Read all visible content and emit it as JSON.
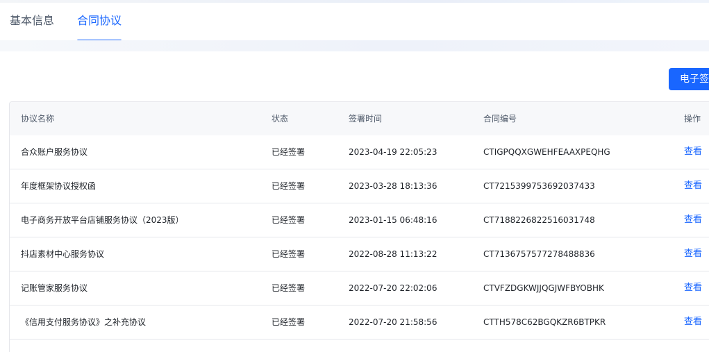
{
  "tabs": [
    {
      "label": "基本信息",
      "active": false
    },
    {
      "label": "合同协议",
      "active": true
    }
  ],
  "toolbar": {
    "e_sign_label": "电子签"
  },
  "table": {
    "headers": [
      "协议名称",
      "状态",
      "签署时间",
      "合同编号",
      "操作"
    ],
    "rows": [
      {
        "name": "合众账户服务协议",
        "status": "已经签署",
        "time": "2023-04-19 22:05:23",
        "id": "CTIGPQQXGWEHFEAAXPEQHG",
        "action": "查看"
      },
      {
        "name": "年度框架协议授权函",
        "status": "已经签署",
        "time": "2023-03-28 18:13:36",
        "id": "CT7215399753692037433",
        "action": "查看"
      },
      {
        "name": "电子商务开放平台店铺服务协议（2023版）",
        "status": "已经签署",
        "time": "2023-01-15 06:48:16",
        "id": "CT7188226822516031748",
        "action": "查看"
      },
      {
        "name": "抖店素材中心服务协议",
        "status": "已经签署",
        "time": "2022-08-28 11:13:22",
        "id": "CT7136757577278488836",
        "action": "查看"
      },
      {
        "name": "记账管家服务协议",
        "status": "已经签署",
        "time": "2022-07-20 22:02:06",
        "id": "CTVFZDGKWJJQGJWFBYOBHK",
        "action": "查看"
      },
      {
        "name": "《信用支付服务协议》之补充协议",
        "status": "已经签署",
        "time": "2022-07-20 21:58:56",
        "id": "CTTH578C62BGQKZR6BTPKR",
        "action": "查看"
      }
    ]
  },
  "colors": {
    "accent": "#1966ff",
    "border": "#e5e6eb",
    "header_bg": "#f7f8fa"
  }
}
